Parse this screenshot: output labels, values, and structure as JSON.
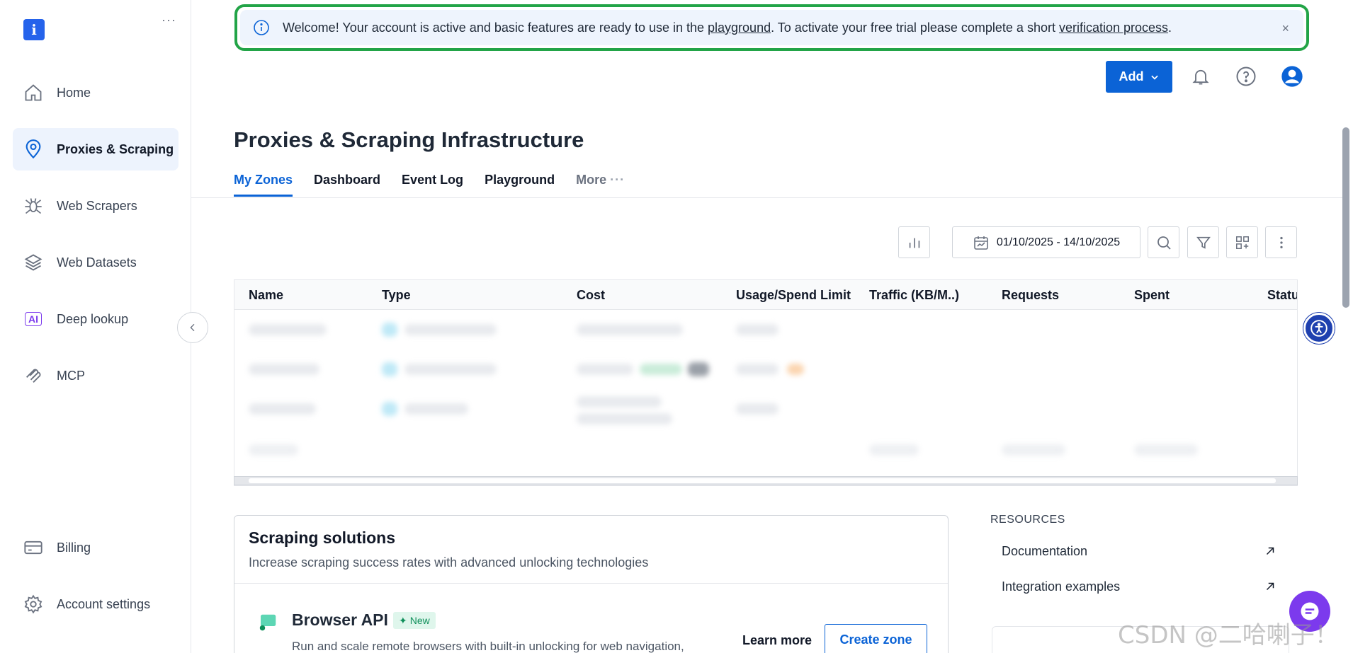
{
  "sidebar": {
    "logo_text": "i",
    "menu_dots": "···",
    "items": [
      {
        "label": "Home",
        "icon": "home-icon"
      },
      {
        "label": "Proxies & Scraping",
        "icon": "location-pin-icon"
      },
      {
        "label": "Web Scrapers",
        "icon": "spider-icon"
      },
      {
        "label": "Web Datasets",
        "icon": "layers-icon"
      },
      {
        "label": "Deep lookup",
        "icon": "ai-badge-icon"
      },
      {
        "label": "MCP",
        "icon": "mcp-icon"
      }
    ],
    "bottom_items": [
      {
        "label": "Billing",
        "icon": "credit-card-icon"
      },
      {
        "label": "Account settings",
        "icon": "gear-icon"
      }
    ],
    "ai_badge_text": "AI"
  },
  "banner": {
    "text_before": "Welcome! Your account is active and basic features are ready to use in the ",
    "link1": "playground",
    "text_middle": ". To activate your free trial please complete a short ",
    "link2": "verification process",
    "text_after": ".",
    "close": "×"
  },
  "header": {
    "add_label": "Add",
    "page_title": "Proxies & Scraping Infrastructure"
  },
  "tabs": [
    {
      "label": "My Zones",
      "active": true
    },
    {
      "label": "Dashboard"
    },
    {
      "label": "Event Log"
    },
    {
      "label": "Playground"
    },
    {
      "label": "More"
    }
  ],
  "toolbar": {
    "date_range": "01/10/2025 - 14/10/2025"
  },
  "table": {
    "columns": [
      "Name",
      "Type",
      "Cost",
      "Usage/Spend Limit",
      "Traffic (KB/M..)",
      "Requests",
      "Spent",
      "Statu"
    ]
  },
  "solutions": {
    "title": "Scraping solutions",
    "subtitle": "Increase scraping success rates with advanced unlocking technologies",
    "item_title": "Browser API",
    "new_badge": "New",
    "item_desc": "Run and scale remote browsers with built-in unlocking for web navigation,",
    "learn_more": "Learn more",
    "create_zone": "Create zone"
  },
  "resources": {
    "heading": "RESOURCES",
    "items": [
      "Documentation",
      "Integration examples"
    ]
  },
  "watermark": "CSDN @二哈喇子！",
  "colors": {
    "primary": "#0b63d6",
    "banner_border": "#22a447",
    "banner_bg": "#eef4fd",
    "active_nav_bg": "#edf3fd"
  }
}
